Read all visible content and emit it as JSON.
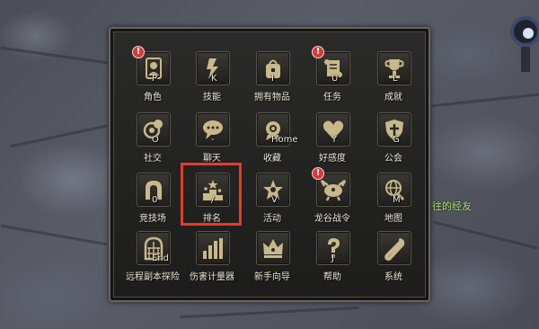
{
  "menu": {
    "items": [
      {
        "label": "角色",
        "hotkey": "P",
        "icon": "character-icon",
        "alert": true
      },
      {
        "label": "技能",
        "hotkey": "K",
        "icon": "skill-icon",
        "alert": false
      },
      {
        "label": "拥有物品",
        "hotkey": "I",
        "icon": "inventory-icon",
        "alert": false
      },
      {
        "label": "任务",
        "hotkey": "U",
        "icon": "quest-scroll-icon",
        "alert": true
      },
      {
        "label": "成就",
        "hotkey": "L",
        "icon": "trophy-icon",
        "alert": false
      },
      {
        "label": "社交",
        "hotkey": "O",
        "icon": "social-icon",
        "alert": false
      },
      {
        "label": "聊天",
        "hotkey": "-",
        "icon": "chat-icon",
        "alert": false
      },
      {
        "label": "收藏",
        "hotkey": "Home",
        "icon": "collection-icon",
        "alert": false
      },
      {
        "label": "好感度",
        "hotkey": "Y",
        "icon": "heart-icon",
        "alert": false
      },
      {
        "label": "公会",
        "hotkey": "G",
        "icon": "guild-shield-icon",
        "alert": false
      },
      {
        "label": "竞技场",
        "hotkey": "0",
        "icon": "arena-icon",
        "alert": false
      },
      {
        "label": "排名",
        "hotkey": "/",
        "icon": "ranking-podium-icon",
        "alert": false
      },
      {
        "label": "活动",
        "hotkey": "V",
        "icon": "event-star-icon",
        "alert": false
      },
      {
        "label": "龙谷战令",
        "hotkey": "",
        "icon": "dragon-valley-icon",
        "alert": true
      },
      {
        "label": "地图",
        "hotkey": "M",
        "icon": "map-globe-icon",
        "alert": false
      },
      {
        "label": "远程副本探险",
        "hotkey": "End",
        "icon": "dungeon-gate-icon",
        "alert": false
      },
      {
        "label": "伤害计量器",
        "hotkey": "",
        "icon": "damage-meter-icon",
        "alert": false
      },
      {
        "label": "新手向导",
        "hotkey": "",
        "icon": "crown-guide-icon",
        "alert": false
      },
      {
        "label": "帮助",
        "hotkey": "J",
        "icon": "help-question-icon",
        "alert": false
      },
      {
        "label": "系统",
        "hotkey": "",
        "icon": "wrench-icon",
        "alert": false
      }
    ],
    "alert_symbol": "!",
    "highlighted_item": "排名"
  },
  "chat_fragment": "往的经友",
  "colors": {
    "panel_bg": "#1c1c1b",
    "icon_color": "#c9b98a",
    "alert": "#d63a3a",
    "highlight": "#e63a2a",
    "chat": "#a8e86a"
  }
}
